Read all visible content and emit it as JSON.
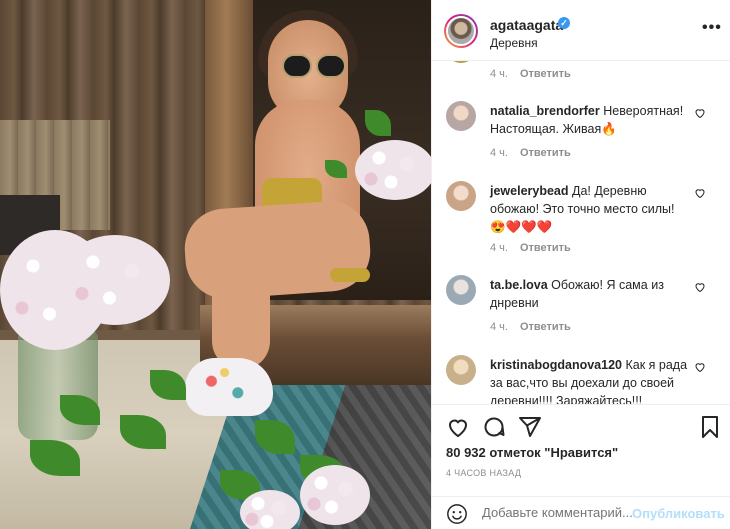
{
  "post": {
    "username": "agataagata",
    "verified_mark": "✓",
    "location": "Деревня",
    "more_label": "•••"
  },
  "top_comment": {
    "time": "4 ч.",
    "reply_label": "Ответить"
  },
  "comments": [
    {
      "username": "natalia_brendorfer",
      "text": "Невероятная! Настоящая. Живая🔥",
      "time": "4 ч.",
      "reply_label": "Ответить",
      "avatar_color": "#b7a6a4"
    },
    {
      "username": "jewelerybead",
      "text": "Да! Деревню обожаю! Это точно место силы! 😍❤️❤️❤️",
      "time": "4 ч.",
      "reply_label": "Ответить",
      "avatar_color": "#c9a487"
    },
    {
      "username": "ta.be.lova",
      "text": "Обожаю! Я сама из днревни",
      "time": "4 ч.",
      "reply_label": "Ответить",
      "avatar_color": "#9aa9b4"
    },
    {
      "username": "kristinabogdanova120",
      "text": "Как я рада за вас,что вы доехали до своей деревни!!!! Заряжайтесь!!!",
      "time": "",
      "reply_label": "",
      "avatar_color": "#c7b08a"
    }
  ],
  "icons": {
    "like": "heart-icon",
    "comment": "comment-icon",
    "share": "share-icon",
    "save": "bookmark-icon",
    "emoji": "smile-icon"
  },
  "stats": {
    "likes_text": "80 932 отметок \"Нравится\"",
    "time_ago": "4 часов назад"
  },
  "add_comment": {
    "placeholder": "Добавьте комментарий...",
    "publish_label": "Опубликовать"
  },
  "colors": {
    "accent": "#3897f0",
    "muted": "#8e8e8e",
    "text": "#262626",
    "publish_disabled": "#b2dffc"
  }
}
